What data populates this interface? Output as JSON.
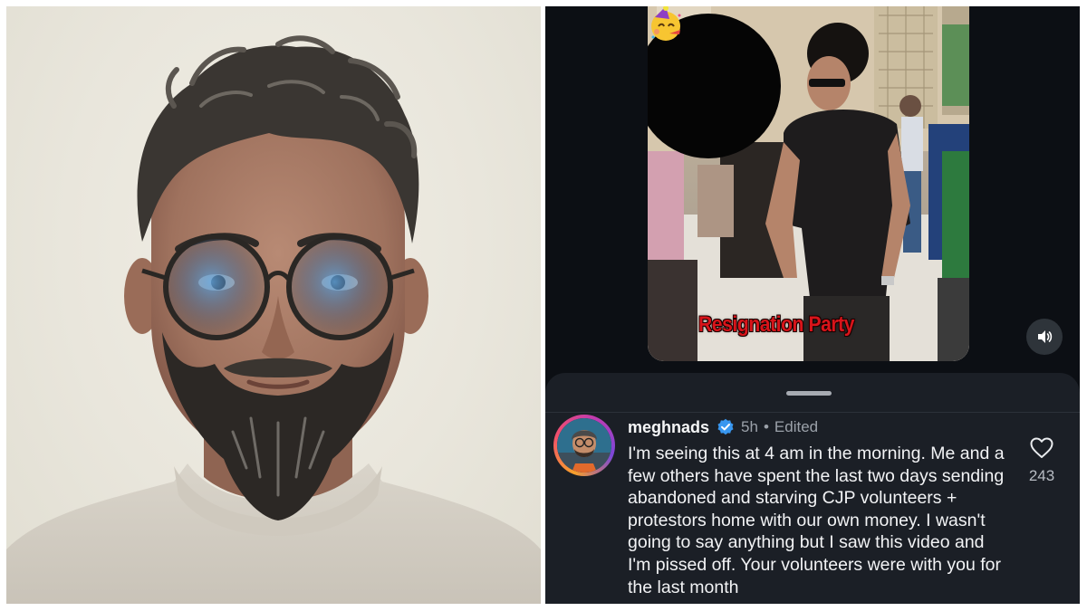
{
  "video": {
    "caption": "Resignation Party",
    "caption_color": "#d8141a",
    "emoji_icon": "partying-face-icon",
    "sound_icon": "speaker-icon"
  },
  "comment": {
    "username": "meghnads",
    "verified": true,
    "time": "5h",
    "separator": "•",
    "edited_label": "Edited",
    "text": "I'm seeing this at 4 am in the morning. Me and a few others have spent the last two days sending abandoned and starving CJP volunteers + protestors home with our own money. I wasn't going to say anything but I saw this video and I'm pissed off. Your volunteers were with you for the last month",
    "likes": "243",
    "like_icon": "heart-outline-icon",
    "verified_color": "#3897f0"
  },
  "theme": {
    "sheet_background": "#1b1f26",
    "app_background": "#0c0f14",
    "text_primary": "#f2f3f5",
    "text_secondary": "#9ba1a9"
  }
}
